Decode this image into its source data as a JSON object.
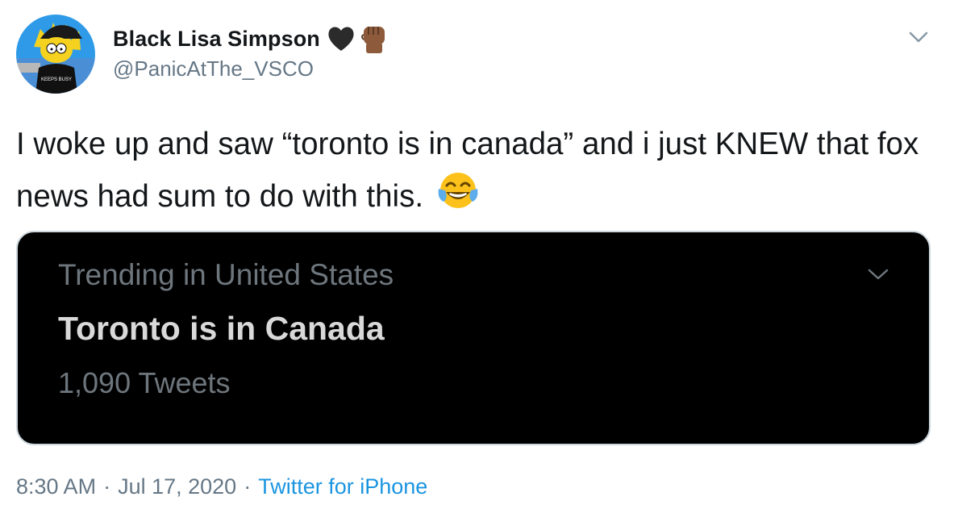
{
  "author": {
    "display_name": "Black Lisa Simpson",
    "handle": "@PanicAtThe_VSCO",
    "avatar_shirt_text": "KEEPS BUSY",
    "emojis": [
      "black-heart-icon",
      "raised-fist-medium-dark-skin-icon"
    ]
  },
  "tweet": {
    "text": "I woke up and saw “toronto is in canada” and i just KNEW that fox news had sum to do with this.",
    "emoji": "face-with-tears-of-joy-icon"
  },
  "media": {
    "trend_context": "Trending in United States",
    "trend_title": "Toronto is in Canada",
    "trend_count": "1,090 Tweets"
  },
  "meta": {
    "time": "8:30 AM",
    "separator": "·",
    "date": "Jul 17, 2020",
    "source": "Twitter for iPhone"
  },
  "colors": {
    "text": "#14171a",
    "secondary": "#657786",
    "link": "#1b95e0",
    "media_bg": "#000000",
    "trend_muted": "#6e767d",
    "trend_title": "#d9d9d9"
  }
}
